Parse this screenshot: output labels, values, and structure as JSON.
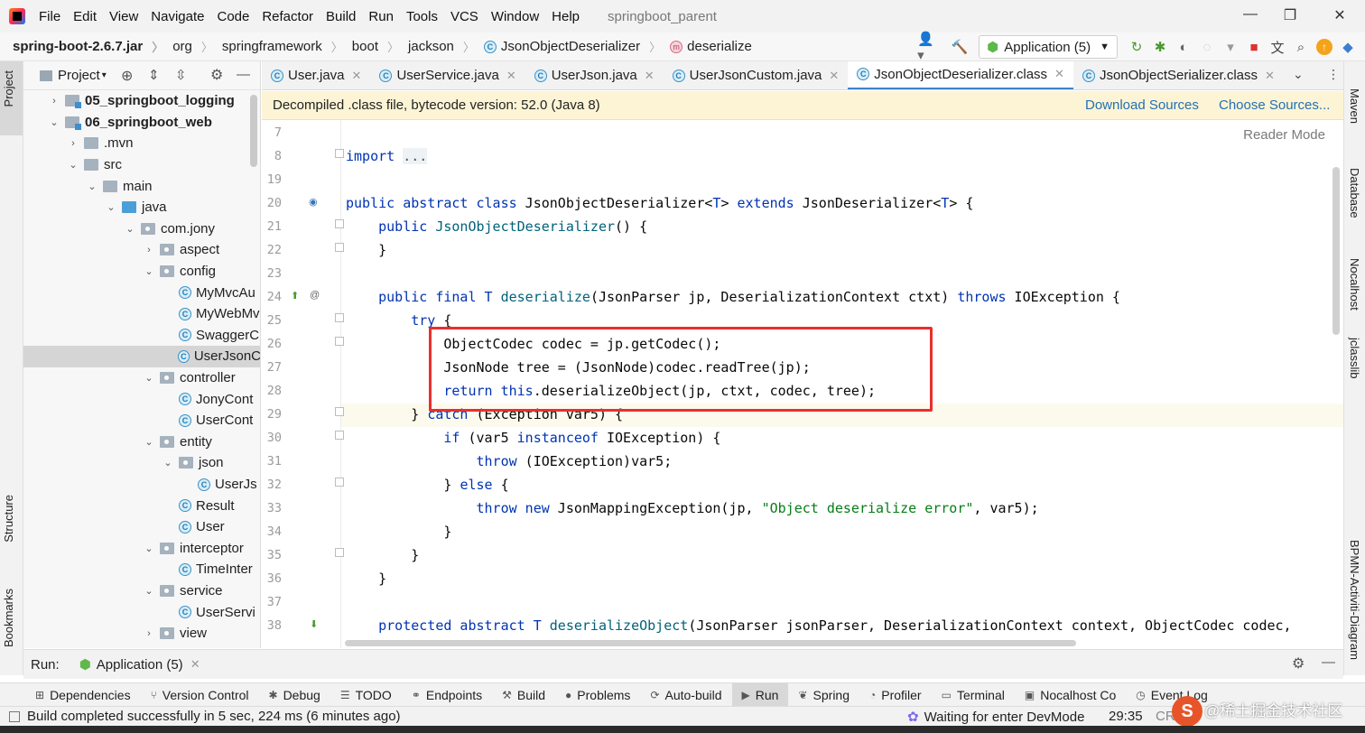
{
  "menubar": {
    "items": [
      "File",
      "Edit",
      "View",
      "Navigate",
      "Code",
      "Refactor",
      "Build",
      "Run",
      "Tools",
      "VCS",
      "Window",
      "Help"
    ],
    "title": "springboot_parent"
  },
  "breadcrumb": {
    "items": [
      "spring-boot-2.6.7.jar",
      "org",
      "springframework",
      "boot",
      "jackson",
      "JsonObjectDeserializer",
      "deserialize"
    ]
  },
  "run_config": {
    "label": "Application (5)"
  },
  "left_stripe": {
    "project": "Project",
    "structure": "Structure",
    "bookmarks": "Bookmarks"
  },
  "right_stripe": {
    "maven": "Maven",
    "database": "Database",
    "nocalhost": "Nocalhost",
    "jclasslib": "jclasslib",
    "bpmn": "BPMN-Activiti-Diagram"
  },
  "project_panel": {
    "header": "Project",
    "tree": [
      {
        "label": "05_springboot_logging",
        "depth": 0,
        "arrow": "›",
        "icon": "module",
        "bold": true
      },
      {
        "label": "06_springboot_web",
        "depth": 0,
        "arrow": "⌄",
        "icon": "module",
        "bold": true
      },
      {
        "label": ".mvn",
        "depth": 1,
        "arrow": "›",
        "icon": "folder"
      },
      {
        "label": "src",
        "depth": 1,
        "arrow": "⌄",
        "icon": "folder"
      },
      {
        "label": "main",
        "depth": 2,
        "arrow": "⌄",
        "icon": "folder"
      },
      {
        "label": "java",
        "depth": 3,
        "arrow": "⌄",
        "icon": "blue"
      },
      {
        "label": "com.jony",
        "depth": 4,
        "arrow": "⌄",
        "icon": "pkg"
      },
      {
        "label": "aspect",
        "depth": 5,
        "arrow": "›",
        "icon": "pkg"
      },
      {
        "label": "config",
        "depth": 5,
        "arrow": "⌄",
        "icon": "pkg"
      },
      {
        "label": "MyMvcAu",
        "depth": 6,
        "arrow": "",
        "icon": "class"
      },
      {
        "label": "MyWebMv",
        "depth": 6,
        "arrow": "",
        "icon": "class"
      },
      {
        "label": "SwaggerC",
        "depth": 6,
        "arrow": "",
        "icon": "class"
      },
      {
        "label": "UserJsonC",
        "depth": 6,
        "arrow": "",
        "icon": "class",
        "selected": true
      },
      {
        "label": "controller",
        "depth": 5,
        "arrow": "⌄",
        "icon": "pkg"
      },
      {
        "label": "JonyCont",
        "depth": 6,
        "arrow": "",
        "icon": "class"
      },
      {
        "label": "UserCont",
        "depth": 6,
        "arrow": "",
        "icon": "class"
      },
      {
        "label": "entity",
        "depth": 5,
        "arrow": "⌄",
        "icon": "pkg"
      },
      {
        "label": "json",
        "depth": 6,
        "arrow": "⌄",
        "icon": "pkg"
      },
      {
        "label": "UserJs",
        "depth": 7,
        "arrow": "",
        "icon": "class"
      },
      {
        "label": "Result",
        "depth": 6,
        "arrow": "",
        "icon": "class"
      },
      {
        "label": "User",
        "depth": 6,
        "arrow": "",
        "icon": "class"
      },
      {
        "label": "interceptor",
        "depth": 5,
        "arrow": "⌄",
        "icon": "pkg"
      },
      {
        "label": "TimeInter",
        "depth": 6,
        "arrow": "",
        "icon": "class"
      },
      {
        "label": "service",
        "depth": 5,
        "arrow": "⌄",
        "icon": "pkg"
      },
      {
        "label": "UserServi",
        "depth": 6,
        "arrow": "",
        "icon": "class"
      },
      {
        "label": "view",
        "depth": 5,
        "arrow": "›",
        "icon": "pkg"
      }
    ]
  },
  "tabs": [
    {
      "label": "User.java",
      "active": false
    },
    {
      "label": "UserService.java",
      "active": false
    },
    {
      "label": "UserJson.java",
      "active": false
    },
    {
      "label": "UserJsonCustom.java",
      "active": false
    },
    {
      "label": "JsonObjectDeserializer.class",
      "active": true
    },
    {
      "label": "JsonObjectSerializer.class",
      "active": false
    }
  ],
  "banner": {
    "text": "Decompiled .class file, bytecode version: 52.0 (Java 8)",
    "download": "Download Sources",
    "choose": "Choose Sources..."
  },
  "editor": {
    "reader_mode": "Reader Mode",
    "lines": [
      {
        "n": "7",
        "html": ""
      },
      {
        "n": "8",
        "html": "<span class='kw'>import</span> <span class='dim'>...</span>"
      },
      {
        "n": "19",
        "html": ""
      },
      {
        "n": "20",
        "html": "<span class='kw'>public abstract class</span> JsonObjectDeserializer&lt;<span class='tp'>T</span>&gt; <span class='kw'>extends</span> JsonDeserializer&lt;<span class='tp'>T</span>&gt; {"
      },
      {
        "n": "21",
        "html": "    <span class='kw'>public</span> <span class='fn'>JsonObjectDeserializer</span>() {"
      },
      {
        "n": "22",
        "html": "    }"
      },
      {
        "n": "23",
        "html": ""
      },
      {
        "n": "24",
        "html": "    <span class='kw'>public final</span> <span class='tp'>T</span> <span class='fn'>deserialize</span>(JsonParser jp, DeserializationContext ctxt) <span class='kw'>throws</span> IOException {"
      },
      {
        "n": "25",
        "html": "        <span class='kw'>try</span> {"
      },
      {
        "n": "26",
        "html": "            ObjectCodec codec = jp.getCodec();"
      },
      {
        "n": "27",
        "html": "            JsonNode tree = (JsonNode)codec.readTree(jp);"
      },
      {
        "n": "28",
        "html": "            <span class='kw'>return this</span>.deserializeObject(jp, ctxt, codec, tree);"
      },
      {
        "n": "29",
        "html": "        } <span class='kw'>catch</span> (Exception var5) {"
      },
      {
        "n": "30",
        "html": "            <span class='kw'>if</span> (var5 <span class='kw'>instanceof</span> IOException) {"
      },
      {
        "n": "31",
        "html": "                <span class='kw'>throw</span> (IOException)var5;"
      },
      {
        "n": "32",
        "html": "            } <span class='kw'>else</span> {"
      },
      {
        "n": "33",
        "html": "                <span class='kw'>throw new</span> JsonMappingException(jp, <span class='str'>\"Object deserialize error\"</span>, var5);"
      },
      {
        "n": "34",
        "html": "            }"
      },
      {
        "n": "35",
        "html": "        }"
      },
      {
        "n": "36",
        "html": "    }"
      },
      {
        "n": "37",
        "html": ""
      },
      {
        "n": "38",
        "html": "    <span class='kw'>protected abstract</span> <span class='tp'>T</span> <span class='fn'>deserializeObject</span>(JsonParser jsonParser, DeserializationContext context, ObjectCodec codec,"
      }
    ]
  },
  "runbar": {
    "run_label": "Run:",
    "config": "Application (5)"
  },
  "bottom_tools": [
    "Dependencies",
    "Version Control",
    "Debug",
    "TODO",
    "Endpoints",
    "Build",
    "Problems",
    "Auto-build",
    "Run",
    "Spring",
    "Profiler",
    "Terminal",
    "Nocalhost Co",
    "Event Log"
  ],
  "status": {
    "message": "Build completed successfully in 5 sec, 224 ms (6 minutes ago)",
    "devmode": "Waiting for enter DevMode",
    "position": "29:35",
    "line_sep": "CR",
    "watermark": "@稀土掘金技术社区"
  }
}
